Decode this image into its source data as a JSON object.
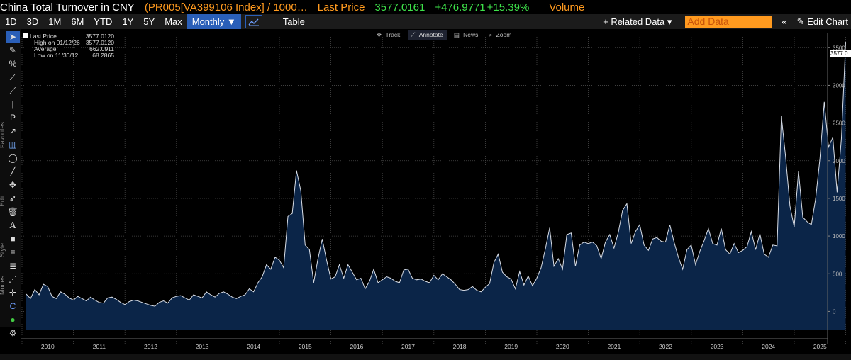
{
  "title_bar": {
    "title": "China Total Turnover in CNY",
    "formula": "(PR005[VA399106 Index] / 1000…",
    "last_price_label": "Last Price",
    "last_price": "3577.0161",
    "change": "+476.9771",
    "change_pct": "+15.39%",
    "volume_label": "Volume"
  },
  "toolbar": {
    "ranges": [
      "1D",
      "3D",
      "1M",
      "6M",
      "YTD",
      "1Y",
      "5Y",
      "Max"
    ],
    "frequency": "Monthly ▼",
    "table_label": "Table",
    "related_data": "+ Related Data ▾",
    "add_data_placeholder": "Add Data",
    "edit_chart": "Edit Chart",
    "collapse_icon": "«",
    "edit_icon": "✎"
  },
  "modes": {
    "track": "Track",
    "annotate": "Annotate",
    "news": "News",
    "zoom": "Zoom"
  },
  "legend": {
    "last_label": "Last Price",
    "last_value": "3577.0120",
    "high_label": "High on 01/12/26",
    "high_value": "3577.0120",
    "avg_label": "Average",
    "avg_value": "662.0911",
    "low_label": "Low on 11/30/12",
    "low_value": "68.2865"
  },
  "last_tag": "3577.0",
  "side_labels": {
    "favorites": "Favorites",
    "edit": "Edit",
    "style": "Style",
    "modes": "Modes"
  },
  "colors": {
    "line": "#d8dde6",
    "area": "#0b2548",
    "grid": "#4a4a4a",
    "accent": "#2a5fb8"
  },
  "chart_data": {
    "type": "area",
    "title": "China Total Turnover in CNY",
    "xlabel": "",
    "ylabel": "",
    "ylim": [
      -250,
      3700
    ],
    "y_ticks": [
      0,
      500,
      1000,
      1500,
      2000,
      2500,
      3000,
      3500
    ],
    "x_tick_labels": [
      "2010",
      "2011",
      "2012",
      "2013",
      "2014",
      "2015",
      "2016",
      "2017",
      "2018",
      "2019",
      "2020",
      "2021",
      "2022",
      "2023",
      "2024",
      "2025"
    ],
    "grid": true,
    "legend_position": "top-left",
    "x_start_year": 2010,
    "values": [
      230,
      170,
      290,
      220,
      360,
      330,
      200,
      170,
      260,
      230,
      180,
      150,
      200,
      170,
      140,
      190,
      150,
      120,
      110,
      180,
      190,
      160,
      120,
      90,
      130,
      150,
      140,
      120,
      100,
      80,
      69,
      120,
      140,
      110,
      180,
      200,
      210,
      180,
      150,
      220,
      200,
      180,
      260,
      220,
      190,
      240,
      260,
      230,
      190,
      170,
      200,
      220,
      300,
      260,
      380,
      460,
      620,
      560,
      720,
      680,
      580,
      1260,
      1300,
      1870,
      1600,
      880,
      820,
      380,
      700,
      960,
      680,
      430,
      460,
      620,
      440,
      620,
      520,
      420,
      440,
      300,
      400,
      560,
      380,
      420,
      460,
      440,
      400,
      380,
      550,
      560,
      440,
      420,
      430,
      400,
      380,
      480,
      420,
      500,
      460,
      420,
      360,
      290,
      280,
      290,
      330,
      280,
      260,
      320,
      370,
      650,
      760,
      520,
      460,
      430,
      300,
      530,
      350,
      470,
      340,
      440,
      580,
      830,
      1110,
      600,
      700,
      560,
      1020,
      1040,
      600,
      880,
      920,
      900,
      920,
      870,
      700,
      920,
      1020,
      840,
      1050,
      1340,
      1430,
      900,
      1060,
      1150,
      880,
      810,
      960,
      980,
      930,
      920,
      1150,
      920,
      720,
      560,
      820,
      880,
      620,
      800,
      940,
      1100,
      900,
      880,
      1100,
      820,
      760,
      900,
      780,
      810,
      860,
      1060,
      820,
      1030,
      760,
      720,
      880,
      870,
      2590,
      2050,
      1400,
      1120,
      1860,
      1250,
      1190,
      1150,
      1500,
      2030,
      2780,
      2180,
      2310,
      1580,
      2300,
      3577
    ]
  }
}
